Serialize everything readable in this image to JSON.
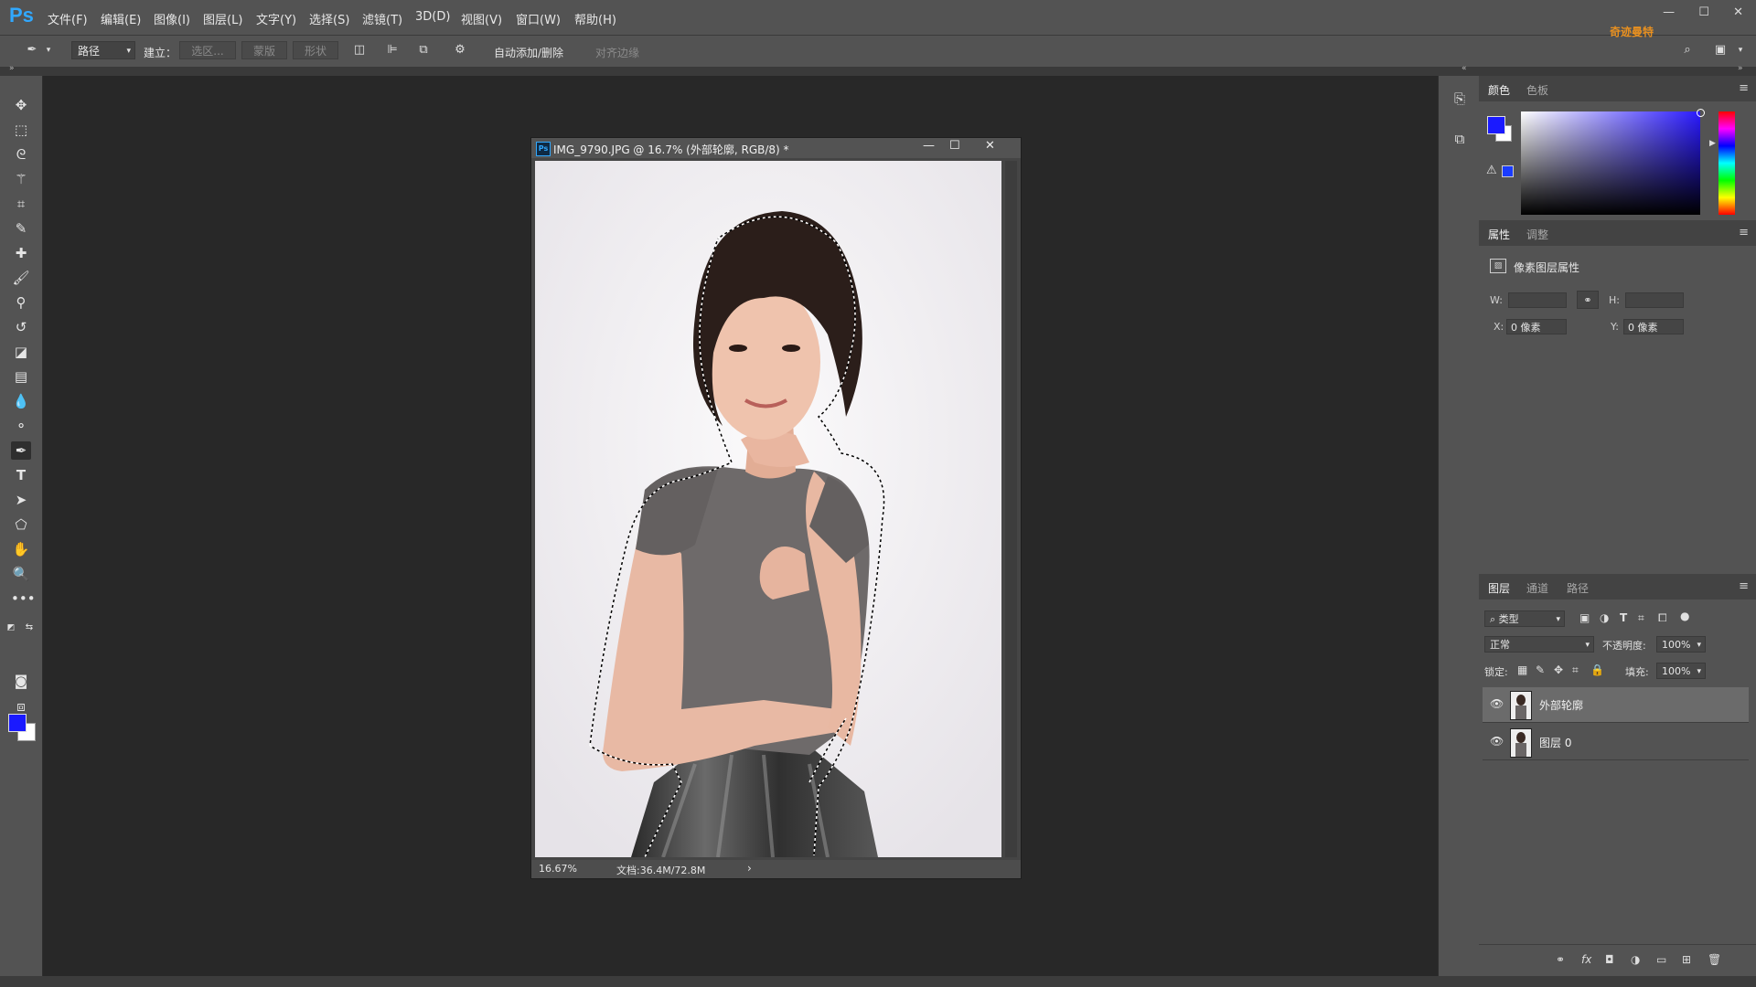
{
  "app": {
    "logo": "Ps"
  },
  "menu": [
    "文件(F)",
    "编辑(E)",
    "图像(I)",
    "图层(L)",
    "文字(Y)",
    "选择(S)",
    "滤镜(T)",
    "3D(D)",
    "视图(V)",
    "窗口(W)",
    "帮助(H)"
  ],
  "options": {
    "mode": "路径",
    "make_label": "建立：",
    "selection_btn": "选区...",
    "mask_btn": "蒙版",
    "shape_btn": "形状",
    "auto_add_label": "自动添加/删除",
    "auto_add_checked": true,
    "align_edges_label": "对齐边缘",
    "align_edges_checked": false
  },
  "brand": "奇迹曼特",
  "document": {
    "title": "IMG_9790.JPG @ 16.7% (外部轮廓, RGB/8) *",
    "zoom": "16.67%",
    "doc_info": "文档:36.4M/72.8M"
  },
  "colors": {
    "foreground": "#1a1aff",
    "background": "#ffffff",
    "accent": "#31a8ff"
  },
  "color_panel": {
    "tabs": [
      "颜色",
      "色板"
    ],
    "active": 0
  },
  "properties_panel": {
    "tabs": [
      "属性",
      "调整"
    ],
    "active": 0,
    "title": "像素图层属性",
    "w_label": "W:",
    "h_label": "H:",
    "w_value": "",
    "h_value": "",
    "x_label": "X:",
    "y_label": "Y:",
    "x_value": "0 像素",
    "y_value": "0 像素"
  },
  "layers_panel": {
    "tabs": [
      "图层",
      "通道",
      "路径"
    ],
    "active": 0,
    "filter_label": "类型",
    "blend_mode": "正常",
    "opacity_label": "不透明度:",
    "opacity": "100%",
    "lock_label": "锁定:",
    "fill_label": "填充:",
    "fill": "100%",
    "layers": [
      {
        "name": "外部轮廓",
        "visible": true,
        "selected": true
      },
      {
        "name": "图层 0",
        "visible": true,
        "selected": false
      }
    ]
  },
  "tools": [
    "move-tool",
    "marquee-tool",
    "lasso-tool",
    "magic-wand-tool",
    "crop-tool",
    "eyedropper-tool",
    "healing-brush-tool",
    "brush-tool",
    "clone-stamp-tool",
    "history-brush-tool",
    "eraser-tool",
    "gradient-tool",
    "blur-tool",
    "dodge-tool",
    "pen-tool",
    "type-tool",
    "path-selection-tool",
    "shape-tool",
    "hand-tool",
    "zoom-tool",
    "more-tools"
  ],
  "active_tool": "pen-tool"
}
